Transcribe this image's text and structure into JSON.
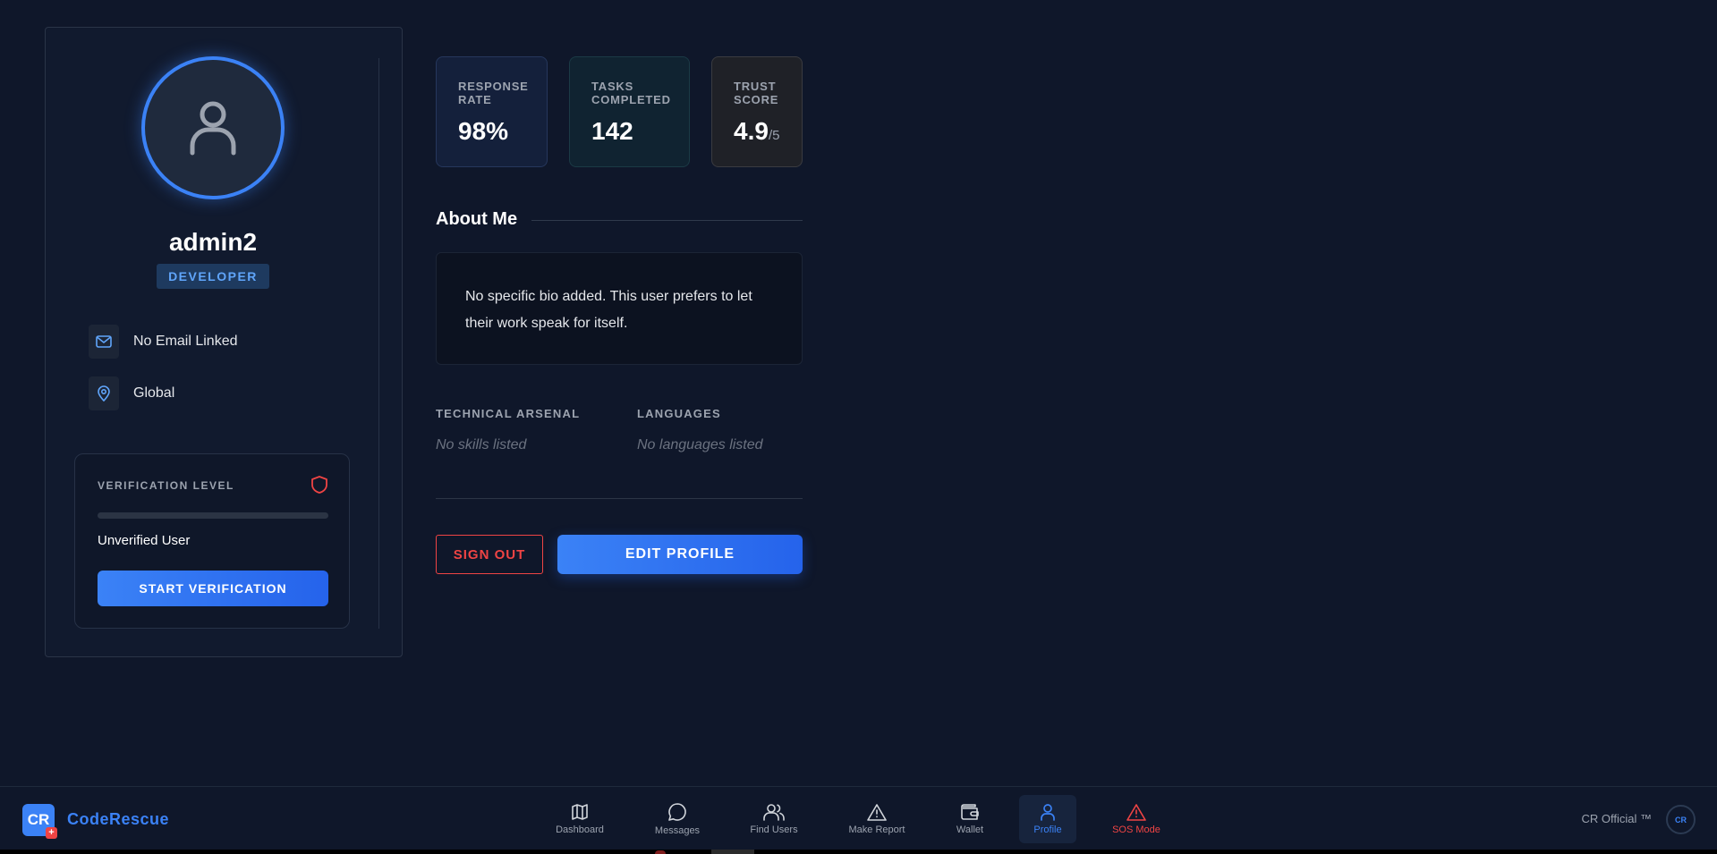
{
  "profile": {
    "username": "admin2",
    "role": "DEVELOPER",
    "email": "No Email Linked",
    "location": "Global",
    "verification": {
      "title": "VERIFICATION LEVEL",
      "progress_percent": 0,
      "status": "Unverified User",
      "button_label": "START VERIFICATION"
    }
  },
  "stats": [
    {
      "label": "RESPONSE RATE",
      "value": "98%",
      "suffix": ""
    },
    {
      "label": "TASKS COMPLETED",
      "value": "142",
      "suffix": ""
    },
    {
      "label": "TRUST SCORE",
      "value": "4.9",
      "suffix": "/5"
    }
  ],
  "about": {
    "title": "About Me",
    "bio": "No specific bio added. This user prefers to let their work speak for itself."
  },
  "sections": {
    "skills_label": "TECHNICAL ARSENAL",
    "skills_empty": "No skills listed",
    "languages_label": "LANGUAGES",
    "languages_empty": "No languages listed"
  },
  "actions": {
    "sign_out": "SIGN OUT",
    "edit_profile": "EDIT PROFILE"
  },
  "nav": {
    "brand_logo": "CR",
    "brand_name": "CodeRescue",
    "items": [
      {
        "label": "Dashboard",
        "icon": "map-icon"
      },
      {
        "label": "Messages",
        "icon": "message-icon"
      },
      {
        "label": "Find Users",
        "icon": "users-icon"
      },
      {
        "label": "Make Report",
        "icon": "alert-triangle-icon"
      },
      {
        "label": "Wallet",
        "icon": "wallet-icon"
      },
      {
        "label": "Profile",
        "icon": "user-icon",
        "active": true
      },
      {
        "label": "SOS Mode",
        "icon": "sos-alert-icon"
      }
    ],
    "official": "CR Official ™",
    "badge": "CR"
  },
  "colors": {
    "background": "#0f172a",
    "accent": "#3b82f6",
    "danger": "#ef4444",
    "muted": "#9ca3af"
  }
}
